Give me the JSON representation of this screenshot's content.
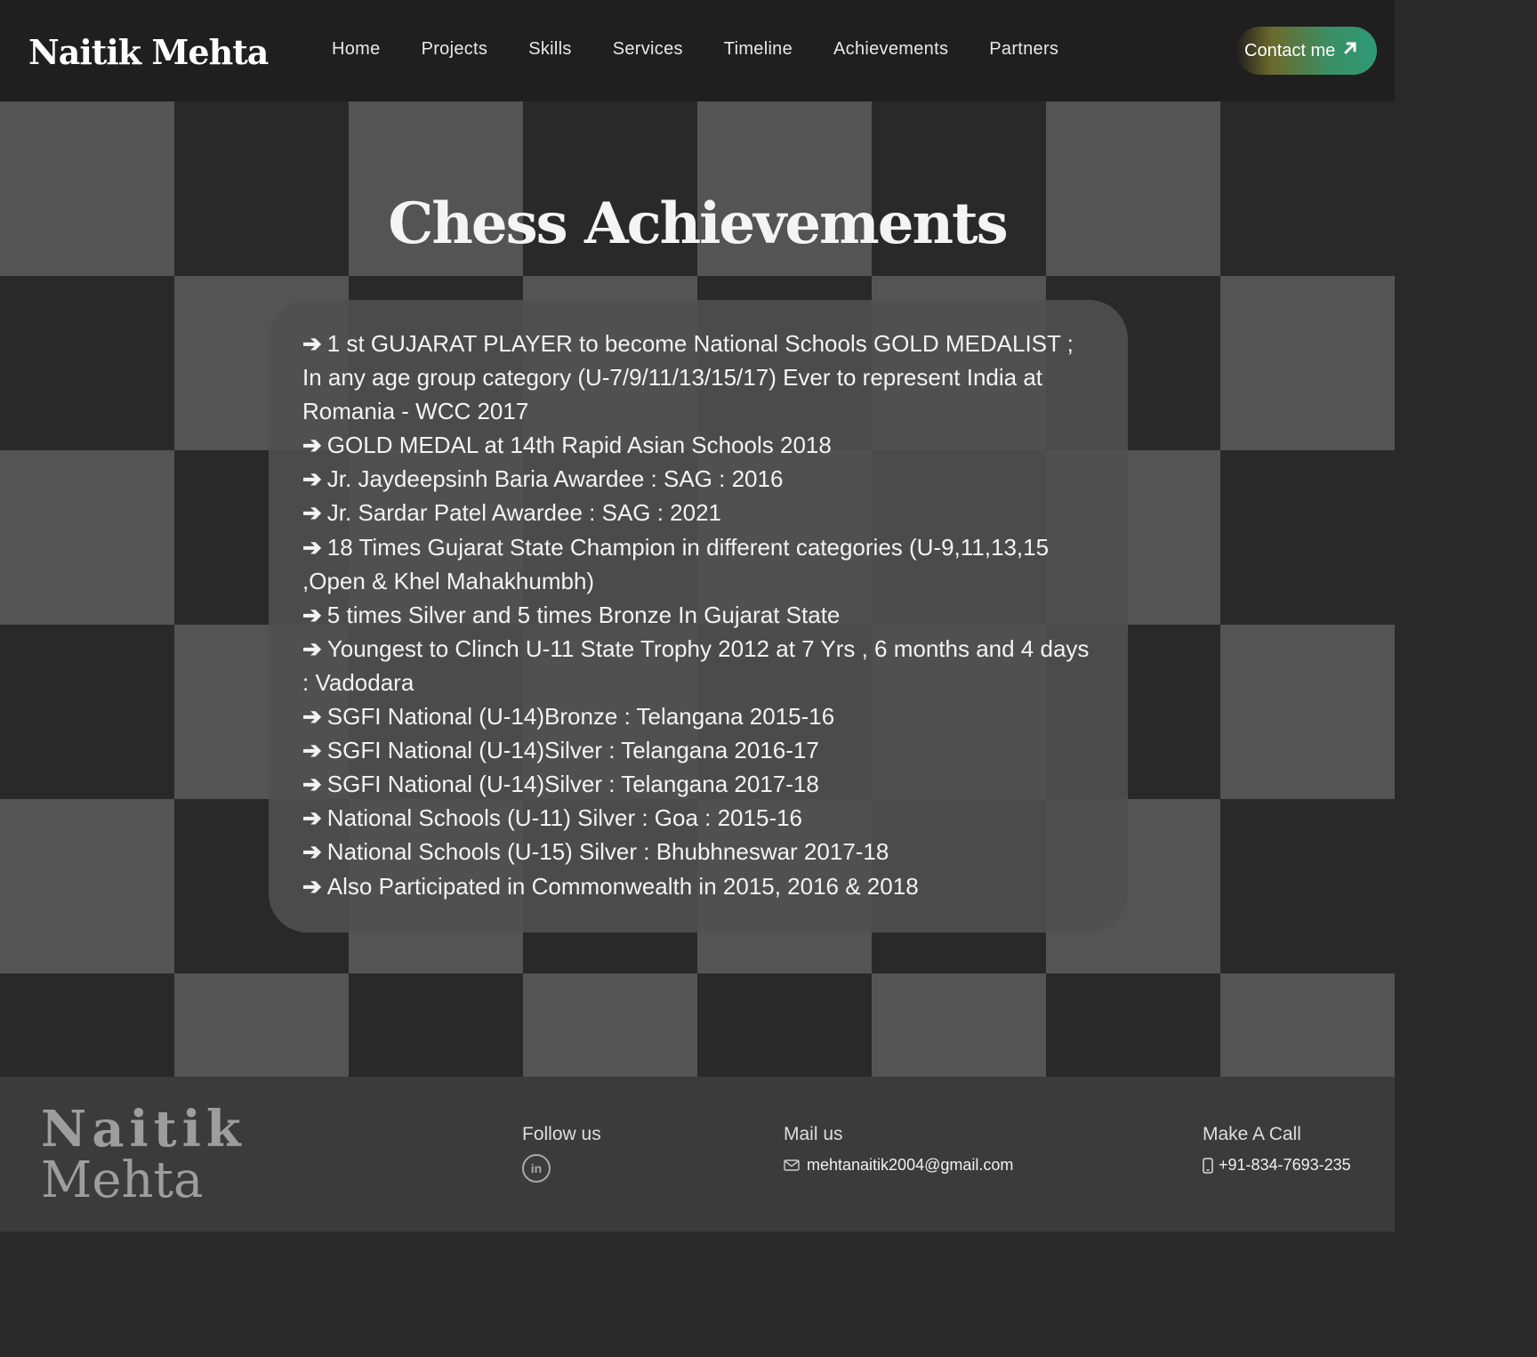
{
  "header": {
    "brand": "Naitik Mehta",
    "nav": [
      "Home",
      "Projects",
      "Skills",
      "Services",
      "Timeline",
      "Achievements",
      "Partners"
    ],
    "contact_label": "Contact me",
    "contact_icon": "arrow-up-right-icon"
  },
  "main": {
    "title": "Chess Achievements",
    "achievements": [
      "1  st GUJARAT PLAYER to become National Schools GOLD MEDALIST ; In any age group category (U-7/9/11/13/15/17) Ever to represent India at Romania - WCC 2017",
      "GOLD MEDAL at 14th Rapid Asian Schools 2018",
      "Jr. Jaydeepsinh Baria Awardee : SAG : 2016",
      "Jr. Sardar Patel Awardee : SAG : 2021",
      "18 Times Gujarat State Champion in different categories (U-9,11,13,15 ,Open & Khel Mahakhumbh)",
      "5 times Silver and 5 times Bronze In Gujarat State",
      "Youngest to Clinch U-11 State Trophy 2012 at 7 Yrs , 6 months and 4 days : Vadodara",
      "SGFI National (U-14)Bronze : Telangana 2015-16",
      "SGFI National (U-14)Silver : Telangana 2016-17",
      "SGFI National (U-14)Silver : Telangana 2017-18",
      "National Schools (U-11) Silver : Goa : 2015-16",
      "National Schools (U-15) Silver : Bhubhneswar 2017-18",
      "Also Participated in Commonwealth in 2015, 2016 & 2018"
    ],
    "bullet": "➔"
  },
  "footer": {
    "brand_line1": "Naitik",
    "brand_line2": "Mehta",
    "follow_label": "Follow us",
    "linkedin_icon": "linkedin-icon",
    "linkedin_text": "in",
    "mail_label": "Mail us",
    "email": "mehtanaitik2004@gmail.com",
    "call_label": "Make A Call",
    "phone": "+91-834-7693-235"
  },
  "colors": {
    "dark_square": "#2a2929",
    "light_square": "#555454",
    "header_bg": "#1f1f1f",
    "accent_green": "#2d9a76"
  }
}
